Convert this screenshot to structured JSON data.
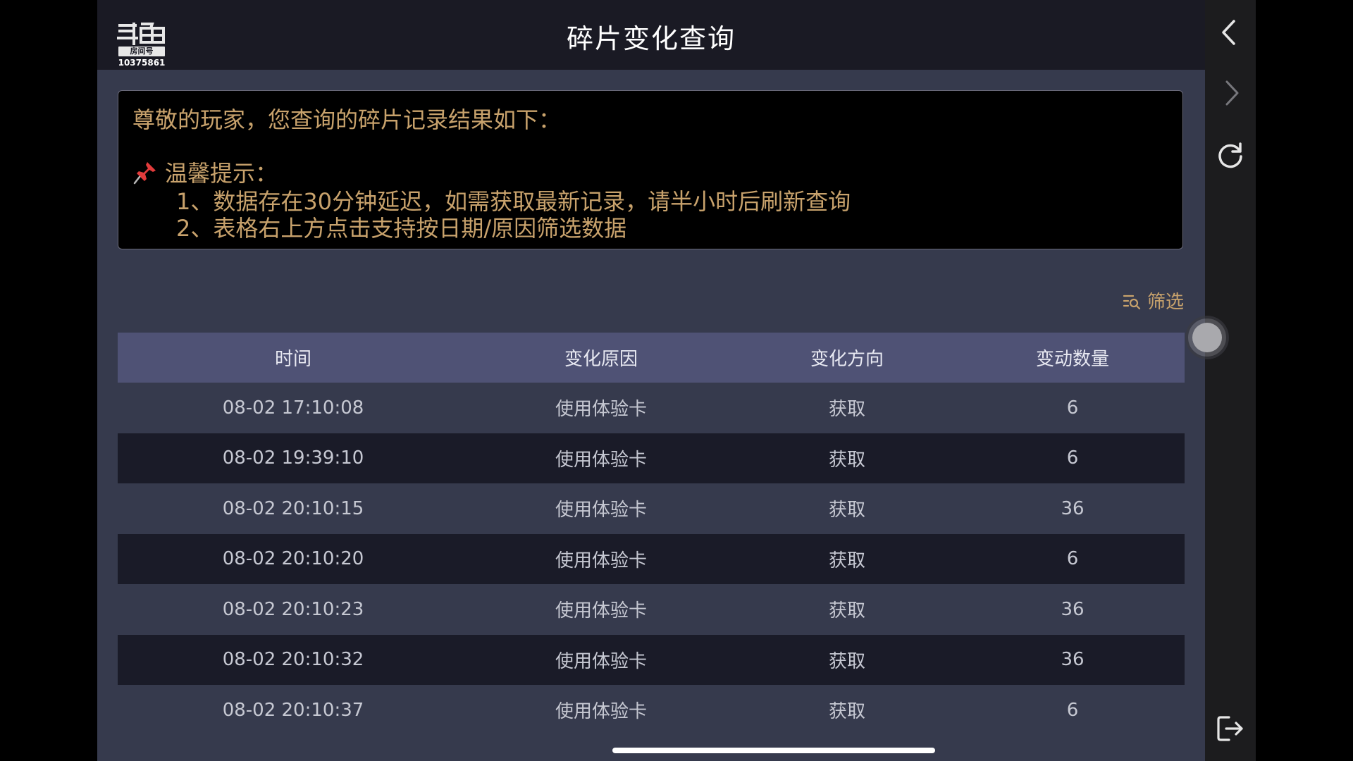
{
  "header": {
    "title": "碎片变化查询",
    "logo_text": "斗鱼",
    "logo_tag": "房间号",
    "room_number": "10375861"
  },
  "notice": {
    "greeting": "尊敬的玩家，您查询的碎片记录结果如下：",
    "tip_title": "温馨提示：",
    "tip_1": "1、数据存在30分钟延迟，如需获取最新记录，请半小时后刷新查询",
    "tip_2": "2、表格右上方点击支持按日期/原因筛选数据"
  },
  "filter": {
    "label": "筛选"
  },
  "table": {
    "columns": [
      "时间",
      "变化原因",
      "变化方向",
      "变动数量"
    ],
    "rows": [
      [
        "08-02 17:10:08",
        "使用体验卡",
        "获取",
        "6"
      ],
      [
        "08-02 19:39:10",
        "使用体验卡",
        "获取",
        "6"
      ],
      [
        "08-02 20:10:15",
        "使用体验卡",
        "获取",
        "36"
      ],
      [
        "08-02 20:10:20",
        "使用体验卡",
        "获取",
        "6"
      ],
      [
        "08-02 20:10:23",
        "使用体验卡",
        "获取",
        "36"
      ],
      [
        "08-02 20:10:32",
        "使用体验卡",
        "获取",
        "36"
      ],
      [
        "08-02 20:10:37",
        "使用体验卡",
        "获取",
        "6"
      ]
    ]
  },
  "sidebar": {
    "icons": [
      "back-icon",
      "forward-icon",
      "refresh-icon",
      "exit-icon"
    ]
  },
  "colors": {
    "accent_gold": "#c8a26c",
    "panel_bg": "#363a4d",
    "header_row": "#4f5275",
    "dark_row": "#1a1b28"
  }
}
